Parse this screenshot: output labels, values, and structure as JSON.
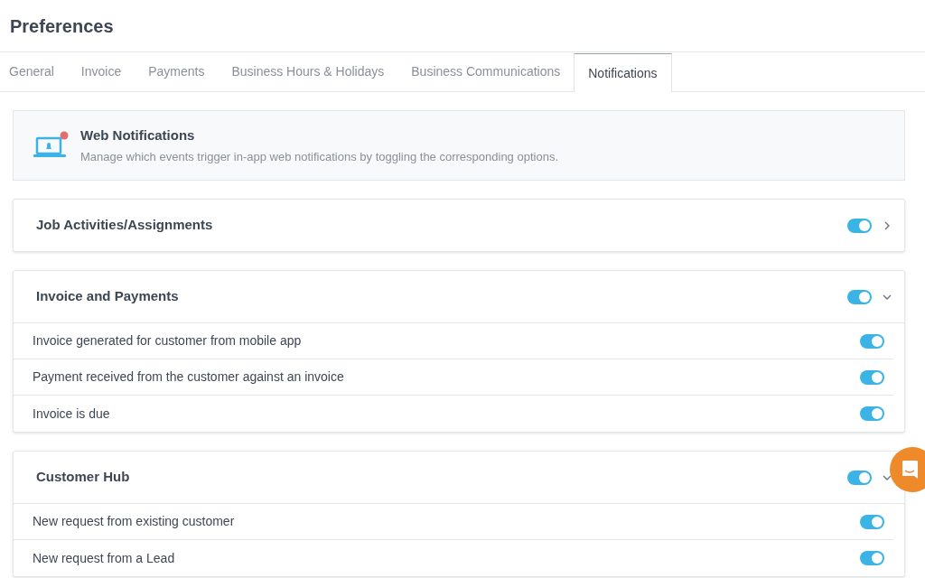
{
  "title": "Preferences",
  "tabs": [
    {
      "label": "General",
      "selected": false
    },
    {
      "label": "Invoice",
      "selected": false
    },
    {
      "label": "Payments",
      "selected": false
    },
    {
      "label": "Business Hours & Holidays",
      "selected": false
    },
    {
      "label": "Business Communications",
      "selected": false
    },
    {
      "label": "Notifications",
      "selected": true
    }
  ],
  "banner": {
    "title": "Web Notifications",
    "description": "Manage which events trigger in-app web notifications by toggling the corresponding options."
  },
  "sections": [
    {
      "title": "Job Activities/Assignments",
      "on": true,
      "expanded": false
    },
    {
      "title": "Invoice and Payments",
      "on": true,
      "expanded": true,
      "items": [
        {
          "label": "Invoice generated for customer from mobile app",
          "on": true
        },
        {
          "label": "Payment received from the customer against an invoice",
          "on": true
        },
        {
          "label": "Invoice is due",
          "on": true
        }
      ]
    },
    {
      "title": "Customer Hub",
      "on": true,
      "expanded": true,
      "items": [
        {
          "label": "New request from existing customer",
          "on": true
        },
        {
          "label": "New request from a Lead",
          "on": true
        }
      ]
    }
  ]
}
